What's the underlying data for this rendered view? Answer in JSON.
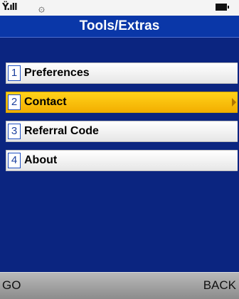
{
  "status_bar": {
    "signal_icon": "signal-strength-icon",
    "signal_glyph": "Ÿ.ıll",
    "gps_icon": "location-gear-icon",
    "gps_glyph": "۞",
    "battery_icon": "battery-full-icon"
  },
  "title": "Tools/Extras",
  "menu": {
    "items": [
      {
        "number": "1",
        "label": "Preferences",
        "selected": false
      },
      {
        "number": "2",
        "label": "Contact",
        "selected": true
      },
      {
        "number": "3",
        "label": "Referral Code",
        "selected": false
      },
      {
        "number": "4",
        "label": "About",
        "selected": false
      }
    ]
  },
  "softkeys": {
    "left": "GO",
    "right": "BACK"
  },
  "colors": {
    "background": "#0b2580",
    "title_bar": "#0a37a8",
    "selected_item": "#ffc400",
    "number_box_border": "#1f4fc2"
  }
}
